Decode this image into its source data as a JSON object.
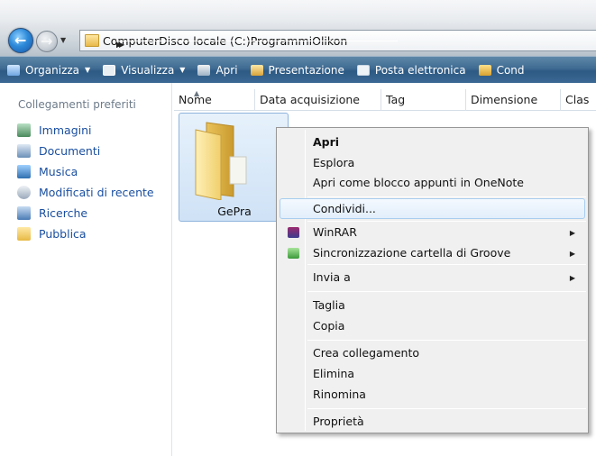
{
  "breadcrumb": [
    "Computer",
    "Disco locale (C:)",
    "Programmi",
    "Olikon"
  ],
  "toolbar": {
    "items": [
      {
        "label": "Organizza",
        "icon": "organize-icon",
        "dropdown": true
      },
      {
        "label": "Visualizza",
        "icon": "views-icon",
        "dropdown": true
      },
      {
        "label": "Apri",
        "icon": "open-icon",
        "dropdown": false
      },
      {
        "label": "Presentazione",
        "icon": "slideshow-icon",
        "dropdown": false
      },
      {
        "label": "Posta elettronica",
        "icon": "email-icon",
        "dropdown": false
      },
      {
        "label": "Cond",
        "icon": "share-icon",
        "dropdown": false
      }
    ]
  },
  "columns": [
    "Nome",
    "Data acquisizione",
    "Tag",
    "Dimensione",
    "Clas"
  ],
  "sidebar": {
    "title": "Collegamenti preferiti",
    "items": [
      {
        "label": "Immagini",
        "icon": "pictures-icon",
        "color": "#4a8a5c"
      },
      {
        "label": "Documenti",
        "icon": "documents-icon",
        "color": "#6a8fb8"
      },
      {
        "label": "Musica",
        "icon": "music-icon",
        "color": "#2f6fb0"
      },
      {
        "label": "Modificati di recente",
        "icon": "recent-icon",
        "color": "#9aa9bb"
      },
      {
        "label": "Ricerche",
        "icon": "searches-icon",
        "color": "#4a7bb5"
      },
      {
        "label": "Pubblica",
        "icon": "public-icon",
        "color": "#e7b944"
      }
    ]
  },
  "folder": {
    "name": "GePra"
  },
  "context_menu": {
    "items": [
      {
        "label": "Apri",
        "bold": true
      },
      {
        "label": "Esplora"
      },
      {
        "label": "Apri come blocco appunti in OneNote"
      },
      {
        "label": "Condividi...",
        "highlighted": true
      },
      {
        "label": "WinRAR",
        "submenu": true,
        "icon": "winrar-icon"
      },
      {
        "label": "Sincronizzazione cartella di Groove",
        "submenu": true,
        "icon": "groove-icon"
      },
      {
        "label": "Invia a",
        "submenu": true
      },
      {
        "label": "Taglia"
      },
      {
        "label": "Copia"
      },
      {
        "label": "Crea collegamento"
      },
      {
        "label": "Elimina"
      },
      {
        "label": "Rinomina"
      },
      {
        "label": "Proprietà"
      }
    ]
  },
  "colors": {
    "toolbar": "#3f6b92",
    "link": "#1a4fa0",
    "menu_bg": "#f0f0f0",
    "highlight_border": "#a8cdef"
  }
}
